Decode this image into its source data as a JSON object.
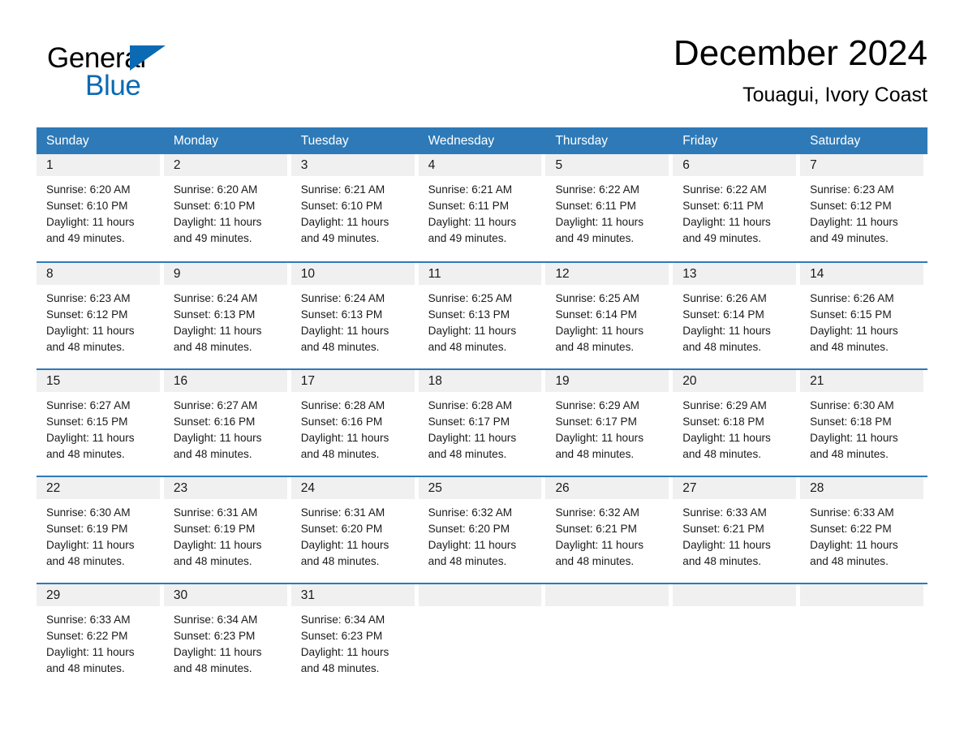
{
  "brand": {
    "name_part1": "General",
    "name_part2": "Blue",
    "logo_icon": "triangle-logo-icon",
    "blue": "#0A6AB4"
  },
  "header": {
    "month_title": "December 2024",
    "location": "Touagui, Ivory Coast"
  },
  "theme": {
    "header_blue": "#2E7AB8",
    "day_band_gray": "#F0F0F0",
    "text_black": "#1a1a1a"
  },
  "weekdays": [
    "Sunday",
    "Monday",
    "Tuesday",
    "Wednesday",
    "Thursday",
    "Friday",
    "Saturday"
  ],
  "labels": {
    "sunrise_prefix": "Sunrise: ",
    "sunset_prefix": "Sunset: ",
    "daylight_prefix": "Daylight: "
  },
  "weeks": [
    [
      {
        "date": "1",
        "sunrise": "Sunrise: 6:20 AM",
        "sunset": "Sunset: 6:10 PM",
        "daylight": "Daylight: 11 hours and 49 minutes."
      },
      {
        "date": "2",
        "sunrise": "Sunrise: 6:20 AM",
        "sunset": "Sunset: 6:10 PM",
        "daylight": "Daylight: 11 hours and 49 minutes."
      },
      {
        "date": "3",
        "sunrise": "Sunrise: 6:21 AM",
        "sunset": "Sunset: 6:10 PM",
        "daylight": "Daylight: 11 hours and 49 minutes."
      },
      {
        "date": "4",
        "sunrise": "Sunrise: 6:21 AM",
        "sunset": "Sunset: 6:11 PM",
        "daylight": "Daylight: 11 hours and 49 minutes."
      },
      {
        "date": "5",
        "sunrise": "Sunrise: 6:22 AM",
        "sunset": "Sunset: 6:11 PM",
        "daylight": "Daylight: 11 hours and 49 minutes."
      },
      {
        "date": "6",
        "sunrise": "Sunrise: 6:22 AM",
        "sunset": "Sunset: 6:11 PM",
        "daylight": "Daylight: 11 hours and 49 minutes."
      },
      {
        "date": "7",
        "sunrise": "Sunrise: 6:23 AM",
        "sunset": "Sunset: 6:12 PM",
        "daylight": "Daylight: 11 hours and 49 minutes."
      }
    ],
    [
      {
        "date": "8",
        "sunrise": "Sunrise: 6:23 AM",
        "sunset": "Sunset: 6:12 PM",
        "daylight": "Daylight: 11 hours and 48 minutes."
      },
      {
        "date": "9",
        "sunrise": "Sunrise: 6:24 AM",
        "sunset": "Sunset: 6:13 PM",
        "daylight": "Daylight: 11 hours and 48 minutes."
      },
      {
        "date": "10",
        "sunrise": "Sunrise: 6:24 AM",
        "sunset": "Sunset: 6:13 PM",
        "daylight": "Daylight: 11 hours and 48 minutes."
      },
      {
        "date": "11",
        "sunrise": "Sunrise: 6:25 AM",
        "sunset": "Sunset: 6:13 PM",
        "daylight": "Daylight: 11 hours and 48 minutes."
      },
      {
        "date": "12",
        "sunrise": "Sunrise: 6:25 AM",
        "sunset": "Sunset: 6:14 PM",
        "daylight": "Daylight: 11 hours and 48 minutes."
      },
      {
        "date": "13",
        "sunrise": "Sunrise: 6:26 AM",
        "sunset": "Sunset: 6:14 PM",
        "daylight": "Daylight: 11 hours and 48 minutes."
      },
      {
        "date": "14",
        "sunrise": "Sunrise: 6:26 AM",
        "sunset": "Sunset: 6:15 PM",
        "daylight": "Daylight: 11 hours and 48 minutes."
      }
    ],
    [
      {
        "date": "15",
        "sunrise": "Sunrise: 6:27 AM",
        "sunset": "Sunset: 6:15 PM",
        "daylight": "Daylight: 11 hours and 48 minutes."
      },
      {
        "date": "16",
        "sunrise": "Sunrise: 6:27 AM",
        "sunset": "Sunset: 6:16 PM",
        "daylight": "Daylight: 11 hours and 48 minutes."
      },
      {
        "date": "17",
        "sunrise": "Sunrise: 6:28 AM",
        "sunset": "Sunset: 6:16 PM",
        "daylight": "Daylight: 11 hours and 48 minutes."
      },
      {
        "date": "18",
        "sunrise": "Sunrise: 6:28 AM",
        "sunset": "Sunset: 6:17 PM",
        "daylight": "Daylight: 11 hours and 48 minutes."
      },
      {
        "date": "19",
        "sunrise": "Sunrise: 6:29 AM",
        "sunset": "Sunset: 6:17 PM",
        "daylight": "Daylight: 11 hours and 48 minutes."
      },
      {
        "date": "20",
        "sunrise": "Sunrise: 6:29 AM",
        "sunset": "Sunset: 6:18 PM",
        "daylight": "Daylight: 11 hours and 48 minutes."
      },
      {
        "date": "21",
        "sunrise": "Sunrise: 6:30 AM",
        "sunset": "Sunset: 6:18 PM",
        "daylight": "Daylight: 11 hours and 48 minutes."
      }
    ],
    [
      {
        "date": "22",
        "sunrise": "Sunrise: 6:30 AM",
        "sunset": "Sunset: 6:19 PM",
        "daylight": "Daylight: 11 hours and 48 minutes."
      },
      {
        "date": "23",
        "sunrise": "Sunrise: 6:31 AM",
        "sunset": "Sunset: 6:19 PM",
        "daylight": "Daylight: 11 hours and 48 minutes."
      },
      {
        "date": "24",
        "sunrise": "Sunrise: 6:31 AM",
        "sunset": "Sunset: 6:20 PM",
        "daylight": "Daylight: 11 hours and 48 minutes."
      },
      {
        "date": "25",
        "sunrise": "Sunrise: 6:32 AM",
        "sunset": "Sunset: 6:20 PM",
        "daylight": "Daylight: 11 hours and 48 minutes."
      },
      {
        "date": "26",
        "sunrise": "Sunrise: 6:32 AM",
        "sunset": "Sunset: 6:21 PM",
        "daylight": "Daylight: 11 hours and 48 minutes."
      },
      {
        "date": "27",
        "sunrise": "Sunrise: 6:33 AM",
        "sunset": "Sunset: 6:21 PM",
        "daylight": "Daylight: 11 hours and 48 minutes."
      },
      {
        "date": "28",
        "sunrise": "Sunrise: 6:33 AM",
        "sunset": "Sunset: 6:22 PM",
        "daylight": "Daylight: 11 hours and 48 minutes."
      }
    ],
    [
      {
        "date": "29",
        "sunrise": "Sunrise: 6:33 AM",
        "sunset": "Sunset: 6:22 PM",
        "daylight": "Daylight: 11 hours and 48 minutes."
      },
      {
        "date": "30",
        "sunrise": "Sunrise: 6:34 AM",
        "sunset": "Sunset: 6:23 PM",
        "daylight": "Daylight: 11 hours and 48 minutes."
      },
      {
        "date": "31",
        "sunrise": "Sunrise: 6:34 AM",
        "sunset": "Sunset: 6:23 PM",
        "daylight": "Daylight: 11 hours and 48 minutes."
      },
      {
        "date": "",
        "sunrise": "",
        "sunset": "",
        "daylight": ""
      },
      {
        "date": "",
        "sunrise": "",
        "sunset": "",
        "daylight": ""
      },
      {
        "date": "",
        "sunrise": "",
        "sunset": "",
        "daylight": ""
      },
      {
        "date": "",
        "sunrise": "",
        "sunset": "",
        "daylight": ""
      }
    ]
  ]
}
